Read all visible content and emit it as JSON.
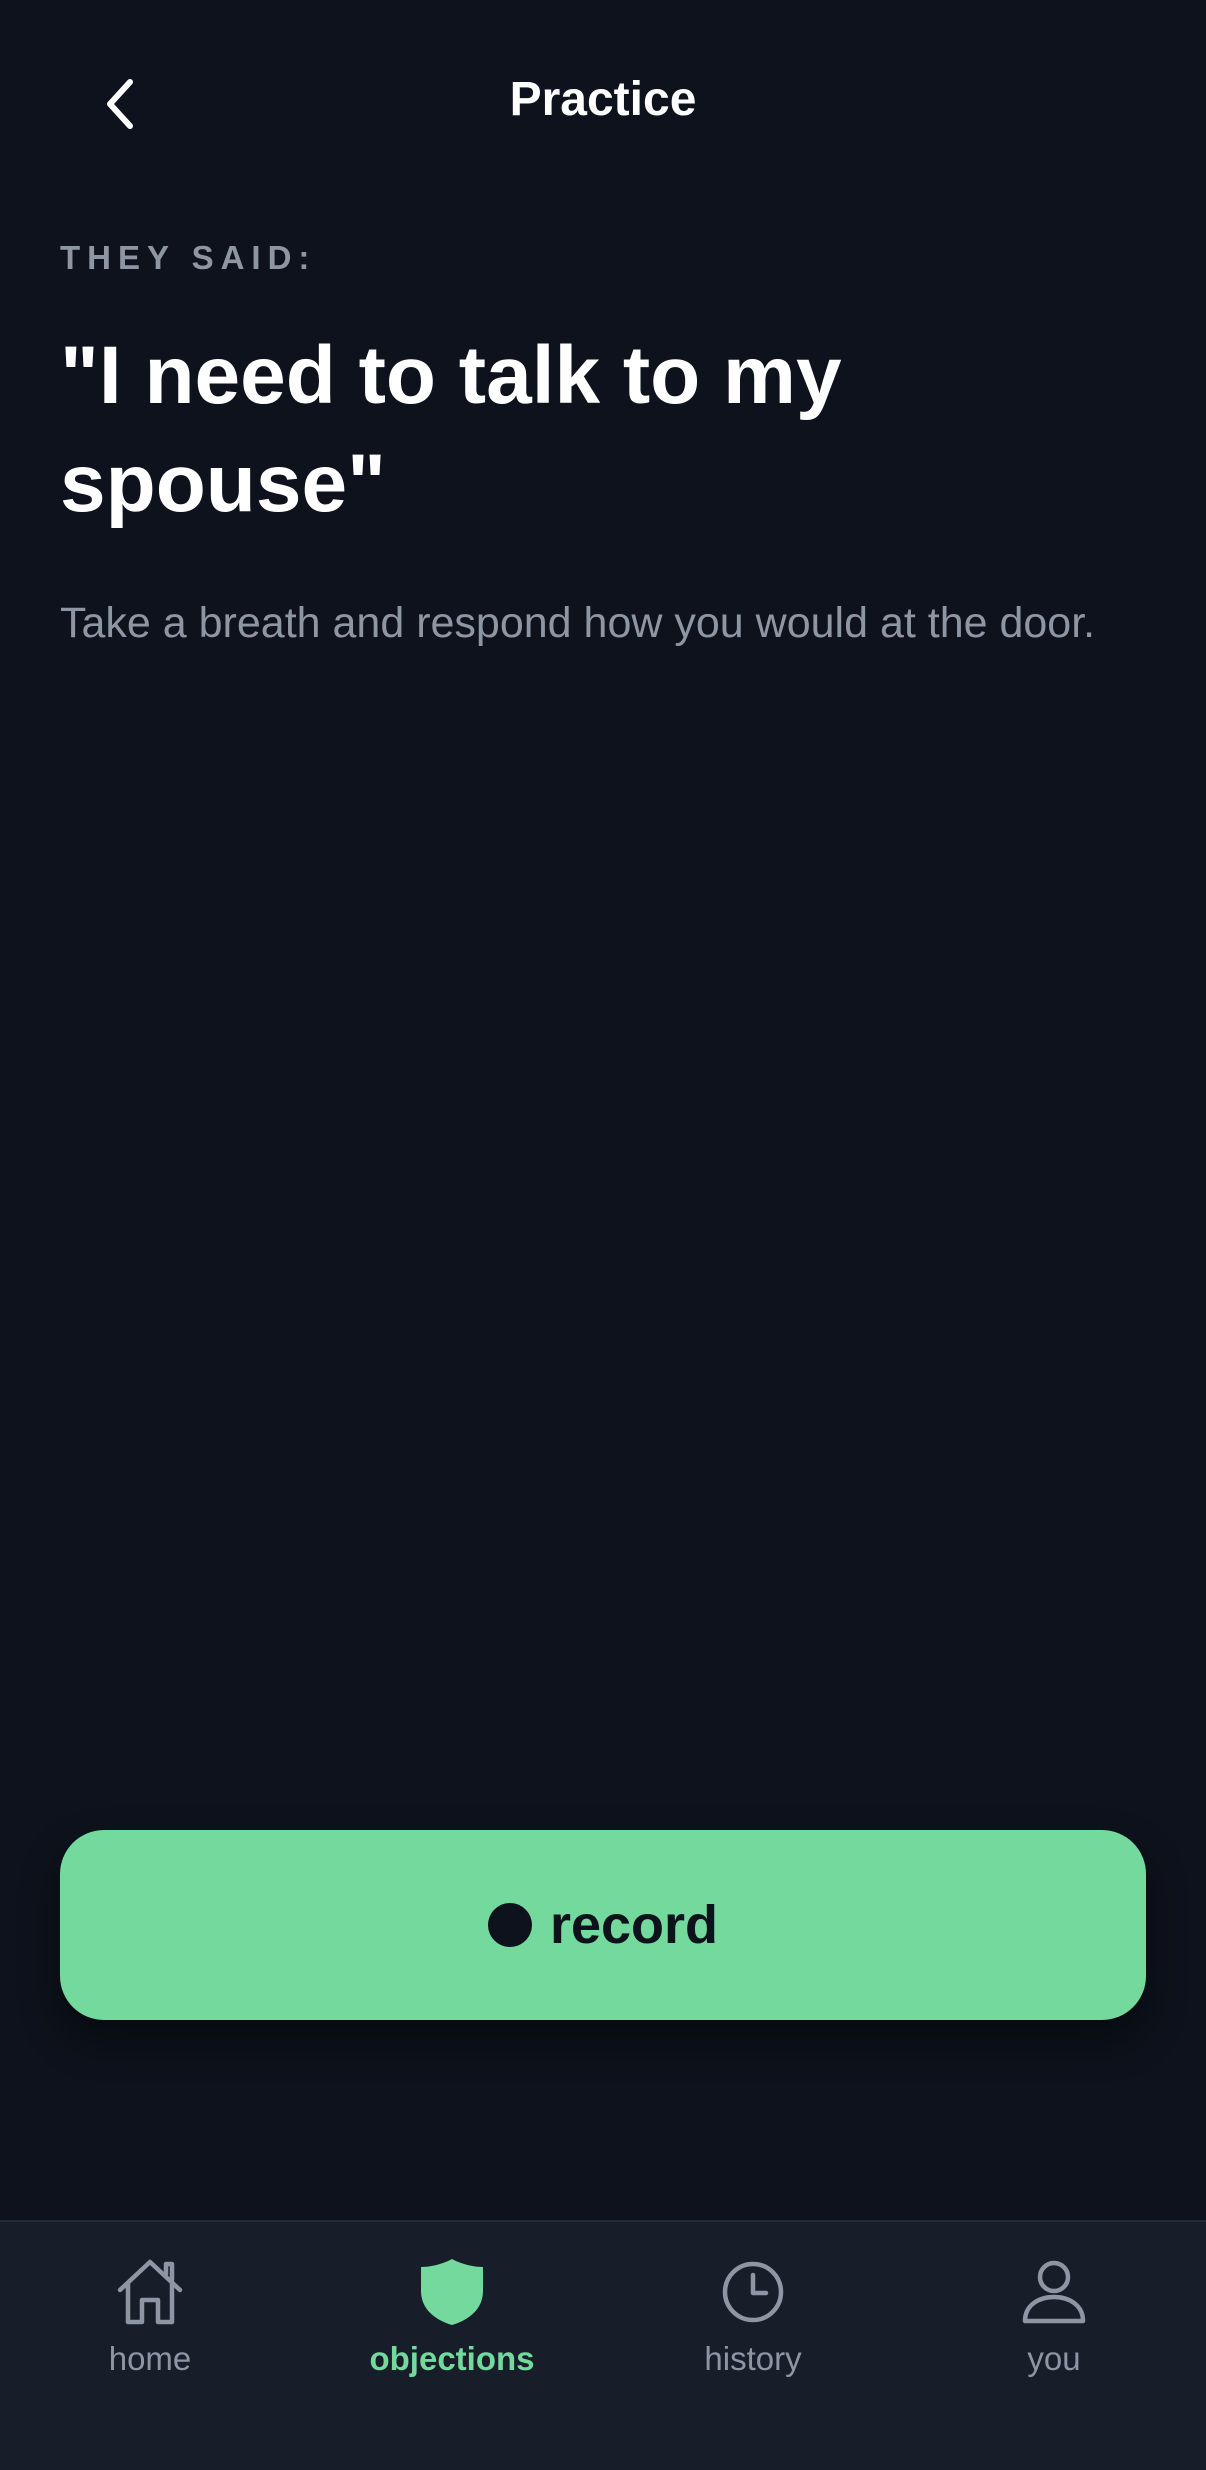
{
  "header": {
    "title": "Practice",
    "back_icon": "chevron-left-icon"
  },
  "main": {
    "eyebrow": "THEY SAID:",
    "quote": "\"I need to talk to my spouse\"",
    "prompt": "Take a breath and respond how you would at the door."
  },
  "record_button": {
    "label": "record",
    "icon": "record-dot-icon",
    "color": "#73d99c"
  },
  "tabs": [
    {
      "label": "home",
      "icon": "home-icon",
      "active": false
    },
    {
      "label": "objections",
      "icon": "shield-icon",
      "active": true
    },
    {
      "label": "history",
      "icon": "clock-icon",
      "active": false
    },
    {
      "label": "you",
      "icon": "person-icon",
      "active": false
    }
  ],
  "colors": {
    "background": "#0d121c",
    "accent": "#73d99c",
    "muted_text": "#8f96a3",
    "tabbar": "#181d2a"
  }
}
